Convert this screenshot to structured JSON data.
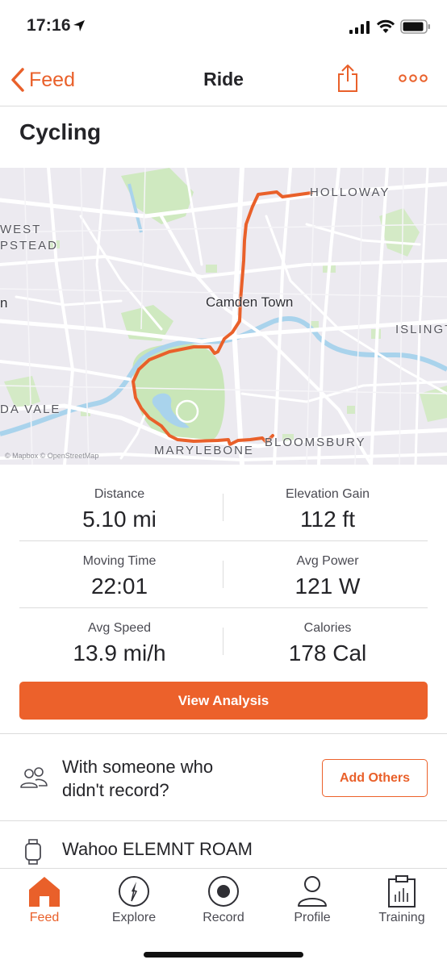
{
  "status_bar": {
    "time": "17:16",
    "icons": [
      "location-arrow-icon",
      "signal-icon",
      "wifi-icon",
      "battery-icon"
    ]
  },
  "nav": {
    "back_label": "Feed",
    "title": "Ride",
    "icons": [
      "chevron-left-icon",
      "share-icon",
      "more-icon"
    ]
  },
  "activity": {
    "title": "Cycling"
  },
  "map": {
    "labels": {
      "holloway": "HOLLOWAY",
      "west_hampstead_1": "WEST",
      "west_hampstead_2": "PSTEAD",
      "kilburn": "n",
      "camden": "Camden Town",
      "islington": "ISLINGT",
      "maida_vale": "DA VALE",
      "marylebone": "MARYLEBONE",
      "bloomsbury": "BLOOMSBURY"
    },
    "attribution": "© Mapbox © OpenStreetMap",
    "route_color": "#e9602a"
  },
  "stats": {
    "distance": {
      "label": "Distance",
      "value": "5.10 mi"
    },
    "elevation": {
      "label": "Elevation Gain",
      "value": "112 ft"
    },
    "moving_time": {
      "label": "Moving Time",
      "value": "22:01"
    },
    "avg_power": {
      "label": "Avg Power",
      "value": "121 W"
    },
    "avg_speed": {
      "label": "Avg Speed",
      "value": "13.9 mi/h"
    },
    "calories": {
      "label": "Calories",
      "value": "178 Cal"
    }
  },
  "actions": {
    "view_analysis": "View Analysis"
  },
  "others": {
    "line1": "With someone who",
    "line2": "didn't record?",
    "button": "Add Others"
  },
  "device": {
    "name": "Wahoo ELEMNT ROAM"
  },
  "tabs": [
    {
      "label": "Feed",
      "icon": "home-icon",
      "active": true
    },
    {
      "label": "Explore",
      "icon": "compass-icon",
      "active": false
    },
    {
      "label": "Record",
      "icon": "record-icon",
      "active": false
    },
    {
      "label": "Profile",
      "icon": "profile-icon",
      "active": false
    },
    {
      "label": "Training",
      "icon": "training-icon",
      "active": false
    }
  ],
  "colors": {
    "accent": "#e9602a",
    "button_fill": "#ec612b",
    "text": "#242428"
  }
}
